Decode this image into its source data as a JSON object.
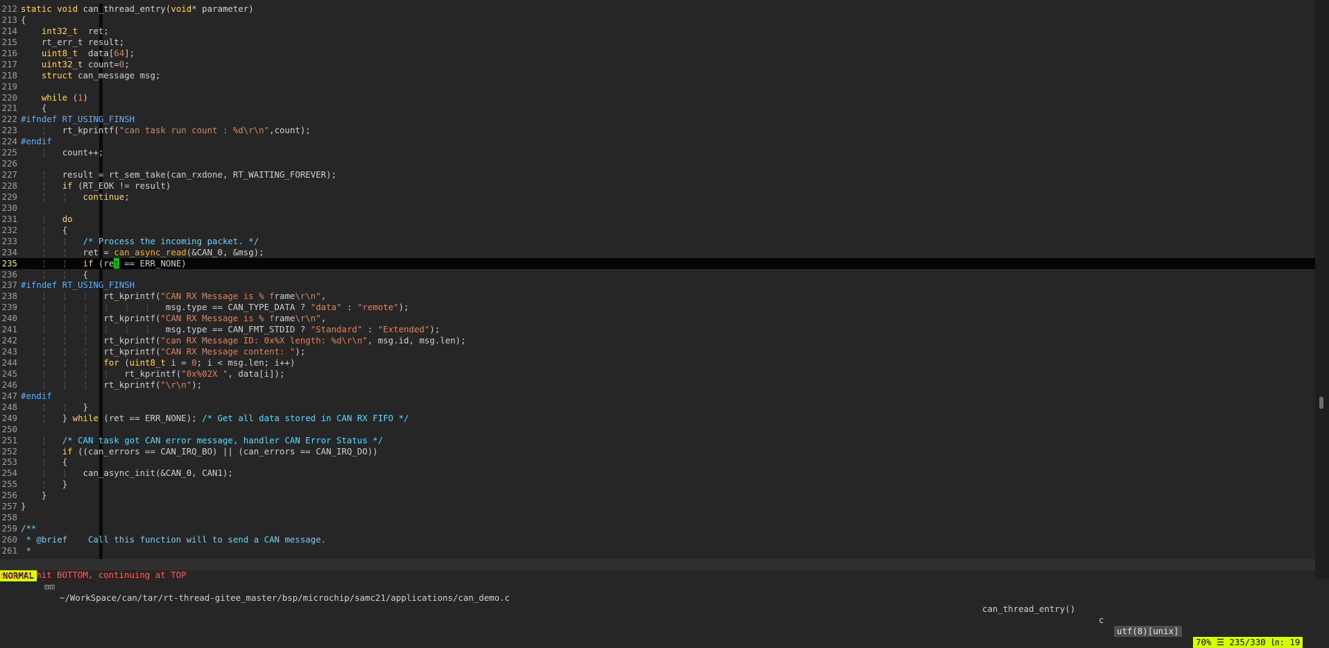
{
  "editor": {
    "current_line": 235,
    "lines": [
      {
        "n": "212",
        "tokens": [
          [
            "kw",
            "static void "
          ],
          [
            "plain",
            "can_thread_entry("
          ],
          [
            "type",
            "void"
          ],
          [
            "plain",
            "* parameter)"
          ]
        ]
      },
      {
        "n": "213",
        "tokens": [
          [
            "plain",
            "{"
          ]
        ]
      },
      {
        "n": "214",
        "tokens": [
          [
            "plain",
            "    "
          ],
          [
            "type",
            "int32_t"
          ],
          [
            "plain",
            "  ret;"
          ]
        ]
      },
      {
        "n": "215",
        "tokens": [
          [
            "plain",
            "    rt_err_t result;"
          ]
        ]
      },
      {
        "n": "216",
        "tokens": [
          [
            "plain",
            "    "
          ],
          [
            "type",
            "uint8_t"
          ],
          [
            "plain",
            "  data["
          ],
          [
            "num",
            "64"
          ],
          [
            "plain",
            "];"
          ]
        ]
      },
      {
        "n": "217",
        "tokens": [
          [
            "plain",
            "    "
          ],
          [
            "type",
            "uint32_t"
          ],
          [
            "plain",
            " count="
          ],
          [
            "num",
            "0"
          ],
          [
            "plain",
            ";"
          ]
        ]
      },
      {
        "n": "218",
        "tokens": [
          [
            "plain",
            "    "
          ],
          [
            "kw",
            "struct"
          ],
          [
            "plain",
            " can_message msg;"
          ]
        ]
      },
      {
        "n": "219",
        "tokens": []
      },
      {
        "n": "220",
        "tokens": [
          [
            "plain",
            "    "
          ],
          [
            "kw",
            "while"
          ],
          [
            "plain",
            " ("
          ],
          [
            "num",
            "1"
          ],
          [
            "plain",
            ")"
          ]
        ]
      },
      {
        "n": "221",
        "tokens": [
          [
            "plain",
            "    {"
          ]
        ]
      },
      {
        "n": "222",
        "tokens": [
          [
            "pre",
            "#ifndef RT_USING_FINSH"
          ]
        ]
      },
      {
        "n": "223",
        "tokens": [
          [
            "guide",
            "    ¦   "
          ],
          [
            "plain",
            "rt_kprintf("
          ],
          [
            "str",
            "\"can task run count : "
          ],
          [
            "num",
            "%d\\r\\n"
          ],
          [
            "str",
            "\""
          ],
          [
            "plain",
            ",count);"
          ]
        ]
      },
      {
        "n": "224",
        "tokens": [
          [
            "pre",
            "#endif"
          ]
        ]
      },
      {
        "n": "225",
        "tokens": [
          [
            "guide",
            "    ¦   "
          ],
          [
            "plain",
            "count++;"
          ]
        ]
      },
      {
        "n": "226",
        "tokens": []
      },
      {
        "n": "227",
        "tokens": [
          [
            "guide",
            "    ¦   "
          ],
          [
            "plain",
            "result = rt_sem_take(can_rxdone, RT_WAITING_FOREVER);"
          ]
        ]
      },
      {
        "n": "228",
        "tokens": [
          [
            "guide",
            "    ¦   "
          ],
          [
            "kw",
            "if"
          ],
          [
            "plain",
            " (RT_EOK != result)"
          ]
        ]
      },
      {
        "n": "229",
        "tokens": [
          [
            "guide",
            "    ¦   ¦   "
          ],
          [
            "kw",
            "continue"
          ],
          [
            "plain",
            ";"
          ]
        ]
      },
      {
        "n": "230",
        "tokens": []
      },
      {
        "n": "231",
        "tokens": [
          [
            "guide",
            "    ¦   "
          ],
          [
            "kw",
            "do"
          ]
        ]
      },
      {
        "n": "232",
        "tokens": [
          [
            "guide",
            "    ¦   "
          ],
          [
            "plain",
            "{"
          ]
        ]
      },
      {
        "n": "233",
        "tokens": [
          [
            "guide",
            "    ¦   ¦   "
          ],
          [
            "com",
            "/* Process the incoming packet. */"
          ]
        ]
      },
      {
        "n": "234",
        "tokens": [
          [
            "guide",
            "    ¦   ¦   "
          ],
          [
            "plain",
            "ret = "
          ],
          [
            "fn",
            "can_async_read"
          ],
          [
            "plain",
            "(&CAN_0, &msg);"
          ]
        ]
      },
      {
        "n": "235",
        "tokens": [
          [
            "guide",
            "    ¦   ¦   "
          ],
          [
            "kw",
            "if"
          ],
          [
            "plain",
            " (re"
          ],
          [
            "cursor",
            "t"
          ],
          [
            "plain",
            " == ERR_NONE)"
          ]
        ]
      },
      {
        "n": "236",
        "tokens": [
          [
            "guide",
            "    ¦   ¦   "
          ],
          [
            "plain",
            "{"
          ]
        ]
      },
      {
        "n": "237",
        "tokens": [
          [
            "pre",
            "#ifndef RT_USING_FINSH"
          ]
        ]
      },
      {
        "n": "238",
        "tokens": [
          [
            "guide",
            "    ¦   ¦   ¦   "
          ],
          [
            "plain",
            "rt_kprintf("
          ],
          [
            "str",
            "\"CAN RX Message is % f"
          ],
          [
            "plain",
            "rame"
          ],
          [
            "str",
            "\\r\\n\""
          ],
          [
            "plain",
            ","
          ]
        ]
      },
      {
        "n": "239",
        "tokens": [
          [
            "guide",
            "    ¦   ¦   ¦   ¦   ¦   ¦   "
          ],
          [
            "plain",
            "msg.type == CAN_TYPE_DATA ? "
          ],
          [
            "str",
            "\"data\""
          ],
          [
            "plain",
            " : "
          ],
          [
            "str",
            "\"remote\""
          ],
          [
            "plain",
            ");"
          ]
        ]
      },
      {
        "n": "240",
        "tokens": [
          [
            "guide",
            "    ¦   ¦   ¦   "
          ],
          [
            "plain",
            "rt_kprintf("
          ],
          [
            "str",
            "\"CAN RX Message is % f"
          ],
          [
            "plain",
            "rame"
          ],
          [
            "str",
            "\\r\\n\""
          ],
          [
            "plain",
            ","
          ]
        ]
      },
      {
        "n": "241",
        "tokens": [
          [
            "guide",
            "    ¦   ¦   ¦   ¦   ¦   ¦   "
          ],
          [
            "plain",
            "msg.type == CAN_FMT_STDID ? "
          ],
          [
            "str",
            "\"Standard\""
          ],
          [
            "plain",
            " : "
          ],
          [
            "str",
            "\"Extended\""
          ],
          [
            "plain",
            ");"
          ]
        ]
      },
      {
        "n": "242",
        "tokens": [
          [
            "guide",
            "    ¦   ¦   ¦   "
          ],
          [
            "plain",
            "rt_kprintf("
          ],
          [
            "str",
            "\"can RX Message ID: 0x"
          ],
          [
            "num",
            "%X"
          ],
          [
            "str",
            " length: "
          ],
          [
            "num",
            "%d\\r\\n"
          ],
          [
            "str",
            "\""
          ],
          [
            "plain",
            ", msg.id, msg.len);"
          ]
        ]
      },
      {
        "n": "243",
        "tokens": [
          [
            "guide",
            "    ¦   ¦   ¦   "
          ],
          [
            "plain",
            "rt_kprintf("
          ],
          [
            "str",
            "\"CAN RX Message content: \""
          ],
          [
            "plain",
            ");"
          ]
        ]
      },
      {
        "n": "244",
        "tokens": [
          [
            "guide",
            "    ¦   ¦   ¦   "
          ],
          [
            "kw",
            "for"
          ],
          [
            "plain",
            " ("
          ],
          [
            "type",
            "uint8_t"
          ],
          [
            "plain",
            " i = "
          ],
          [
            "num",
            "0"
          ],
          [
            "plain",
            "; i < msg.len; i++)"
          ]
        ]
      },
      {
        "n": "245",
        "tokens": [
          [
            "guide",
            "    ¦   ¦   ¦   ¦   "
          ],
          [
            "plain",
            "rt_kprintf("
          ],
          [
            "str",
            "\"0x"
          ],
          [
            "num",
            "%02X"
          ],
          [
            "str",
            " \""
          ],
          [
            "plain",
            ", data[i]);"
          ]
        ]
      },
      {
        "n": "246",
        "tokens": [
          [
            "guide",
            "    ¦   ¦   ¦   "
          ],
          [
            "plain",
            "rt_kprintf("
          ],
          [
            "str",
            "\""
          ],
          [
            "num",
            "\\r\\n"
          ],
          [
            "str",
            "\""
          ],
          [
            "plain",
            ");"
          ]
        ]
      },
      {
        "n": "247",
        "tokens": [
          [
            "pre",
            "#endif"
          ]
        ]
      },
      {
        "n": "248",
        "tokens": [
          [
            "guide",
            "    ¦   ¦   "
          ],
          [
            "plain",
            "}"
          ]
        ]
      },
      {
        "n": "249",
        "tokens": [
          [
            "guide",
            "    ¦   "
          ],
          [
            "plain",
            "} "
          ],
          [
            "kw",
            "while"
          ],
          [
            "plain",
            " (ret == ERR_NONE); "
          ],
          [
            "com",
            "/* Get all data stored in CAN RX FIFO */"
          ]
        ]
      },
      {
        "n": "250",
        "tokens": []
      },
      {
        "n": "251",
        "tokens": [
          [
            "guide",
            "    ¦   "
          ],
          [
            "com",
            "/* CAN task got CAN error message, handler CAN Error Status */"
          ]
        ]
      },
      {
        "n": "252",
        "tokens": [
          [
            "guide",
            "    ¦   "
          ],
          [
            "kw",
            "if"
          ],
          [
            "plain",
            " ((can_errors == CAN_IRQ_BO) || (can_errors == CAN_IRQ_DO))"
          ]
        ]
      },
      {
        "n": "253",
        "tokens": [
          [
            "guide",
            "    ¦   "
          ],
          [
            "plain",
            "{"
          ]
        ]
      },
      {
        "n": "254",
        "tokens": [
          [
            "guide",
            "    ¦   ¦   "
          ],
          [
            "plain",
            "can_async_init(&CAN_0, CAN1);"
          ]
        ]
      },
      {
        "n": "255",
        "tokens": [
          [
            "guide",
            "    ¦   "
          ],
          [
            "plain",
            "}"
          ]
        ]
      },
      {
        "n": "256",
        "tokens": [
          [
            "plain",
            "    }"
          ]
        ]
      },
      {
        "n": "257",
        "tokens": [
          [
            "plain",
            "}"
          ]
        ]
      },
      {
        "n": "258",
        "tokens": []
      },
      {
        "n": "259",
        "tokens": [
          [
            "com",
            "/**"
          ]
        ]
      },
      {
        "n": "260",
        "tokens": [
          [
            "com",
            " * @brief    Call this function will to send a CAN message."
          ]
        ]
      },
      {
        "n": "261",
        "tokens": [
          [
            "com",
            " *"
          ]
        ]
      }
    ]
  },
  "scrollbar": {
    "position_fraction": 0.7,
    "thumb_fraction": 0.02
  },
  "statusline": {
    "mode": "NORMAL",
    "mode_separator": "⊟⊡",
    "filepath": "~/WorkSpace/can/tar/rt-thread-gitee_master/bsp/microchip/samc21/applications/can_demo.c",
    "function": "can_thread_entry()",
    "filetype": "c",
    "encoding": "utf(8)[unix]",
    "position": "70% ☰ 235/330 ㏑: 19"
  },
  "cmdline": {
    "message": "search hit BOTTOM, continuing at TOP"
  },
  "colors": {
    "background": "#262626",
    "keyword": "#ffd75f",
    "preproc": "#5fafff",
    "string": "#d7875f",
    "comment": "#5fd7ff",
    "mode_bg": "#d7ff00",
    "cursor": "#00cc00"
  }
}
